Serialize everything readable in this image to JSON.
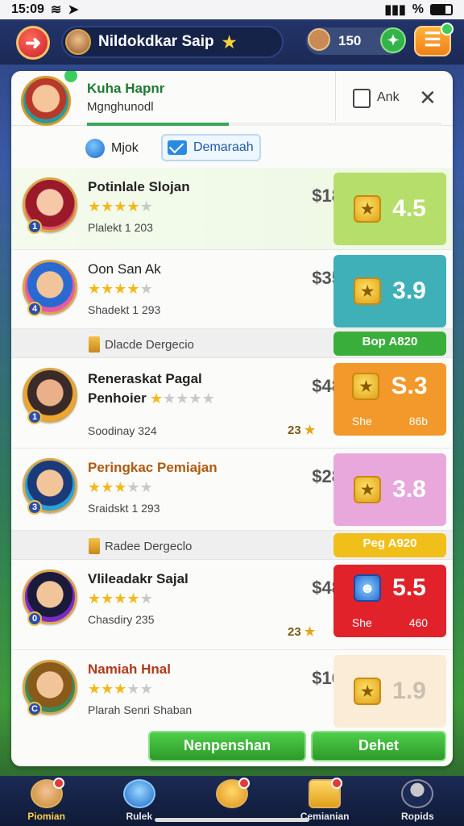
{
  "status": {
    "time": "15:09",
    "battery": "%"
  },
  "header": {
    "title": "Nildokdkar Saip",
    "coins": "150"
  },
  "panel": {
    "title": "Kuha Hapnr",
    "subtitle": "Mgnghunodl",
    "checkbox_label": "Ank",
    "progress": 0.4,
    "tabs": [
      {
        "label": "Mjok"
      },
      {
        "label": "Demaraah"
      }
    ]
  },
  "rows": [
    {
      "name": "Potinlale Slojan",
      "stars": 4,
      "meta": "Plalekt 1 203",
      "price": "$18",
      "score": "4.5",
      "color": "#b6de6a"
    },
    {
      "name": "Oon San Ak",
      "stars": 4,
      "meta": "Shadekt 1 293",
      "price": "$35",
      "score": "3.9",
      "color": "#3fb0b8"
    },
    {
      "name": "Reneraskat Pagal Penhoier",
      "stars": 1,
      "meta": "Soodinay 324",
      "price": "$48",
      "score": "S.3",
      "rating": "23",
      "badge_sub": [
        "She",
        "86b"
      ],
      "color": "#f3982a"
    },
    {
      "name": "Peringkac Pemiajan",
      "stars": 3,
      "meta": "Sraidskt 1 293",
      "price": "$28",
      "score": "3.8",
      "color": "#e8a8dc"
    },
    {
      "name": "Vlileadakr Sajal",
      "stars": 4,
      "meta": "Chasdiry 235",
      "price": "$48",
      "score": "5.5",
      "rating": "23",
      "badge_sub": [
        "She",
        "460"
      ],
      "color": "#e1222a"
    },
    {
      "name": "Namiah Hnal",
      "stars": 3,
      "meta": "Plarah Senri Shaban",
      "price": "$16",
      "score": "1.9",
      "color": "#fbecd8"
    }
  ],
  "separators": [
    {
      "label": "Dlacde Dergecio",
      "button": "Bop A820",
      "color": "#3aae3a"
    },
    {
      "label": "Radee Dergeclo",
      "button": "Peg A920",
      "color": "#f0bf1a"
    }
  ],
  "footer": {
    "left_button": "Nenpenshan",
    "right_button": "Dehet"
  },
  "nav": [
    {
      "label": "Piomian",
      "active": true
    },
    {
      "label": "Rulek"
    },
    {
      "label": ""
    },
    {
      "label": "Cemianian"
    },
    {
      "label": "Ropids"
    }
  ]
}
